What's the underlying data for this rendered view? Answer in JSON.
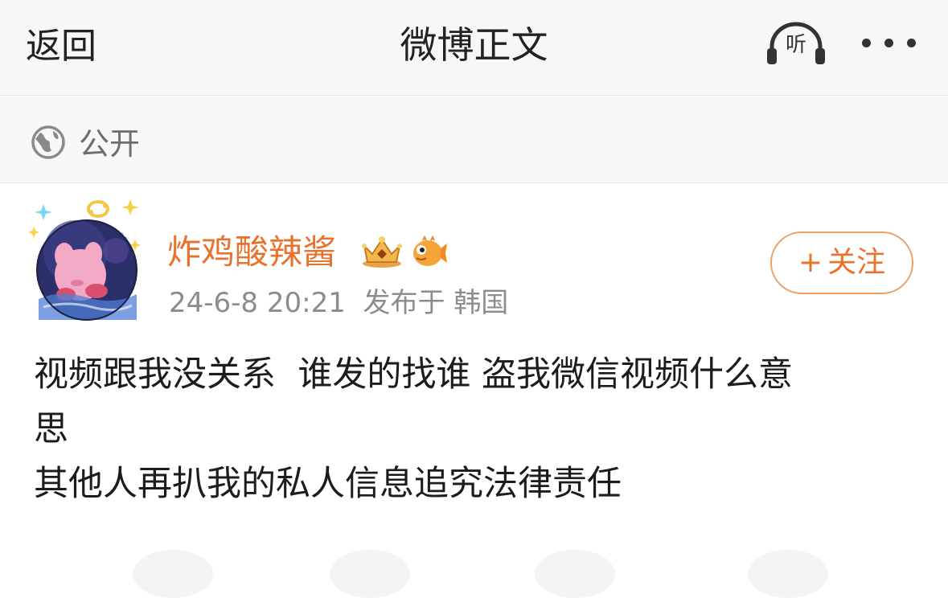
{
  "nav": {
    "back_label": "返回",
    "title": "微博正文",
    "listen_label": "听"
  },
  "visibility": {
    "label": "公开"
  },
  "post": {
    "author": "炸鸡酸辣酱",
    "timestamp": "24-6-8 20:21",
    "source": "发布于 韩国",
    "follow_label": "关注",
    "content": [
      "视频跟我没关系  谁发的找谁 盗我微信视频什么意",
      "思",
      "其他人再扒我的私人信息追究法律责任"
    ]
  },
  "colors": {
    "accent": "#e8722c",
    "follow_border": "#f0a061",
    "nav_bg": "#f7f7f7"
  },
  "icons": {
    "listen": "headphones-icon",
    "more": "more-dots-icon",
    "visibility": "globe-icon",
    "badge_1": "crown-badge-icon",
    "badge_2": "pufferfish-badge-icon"
  }
}
